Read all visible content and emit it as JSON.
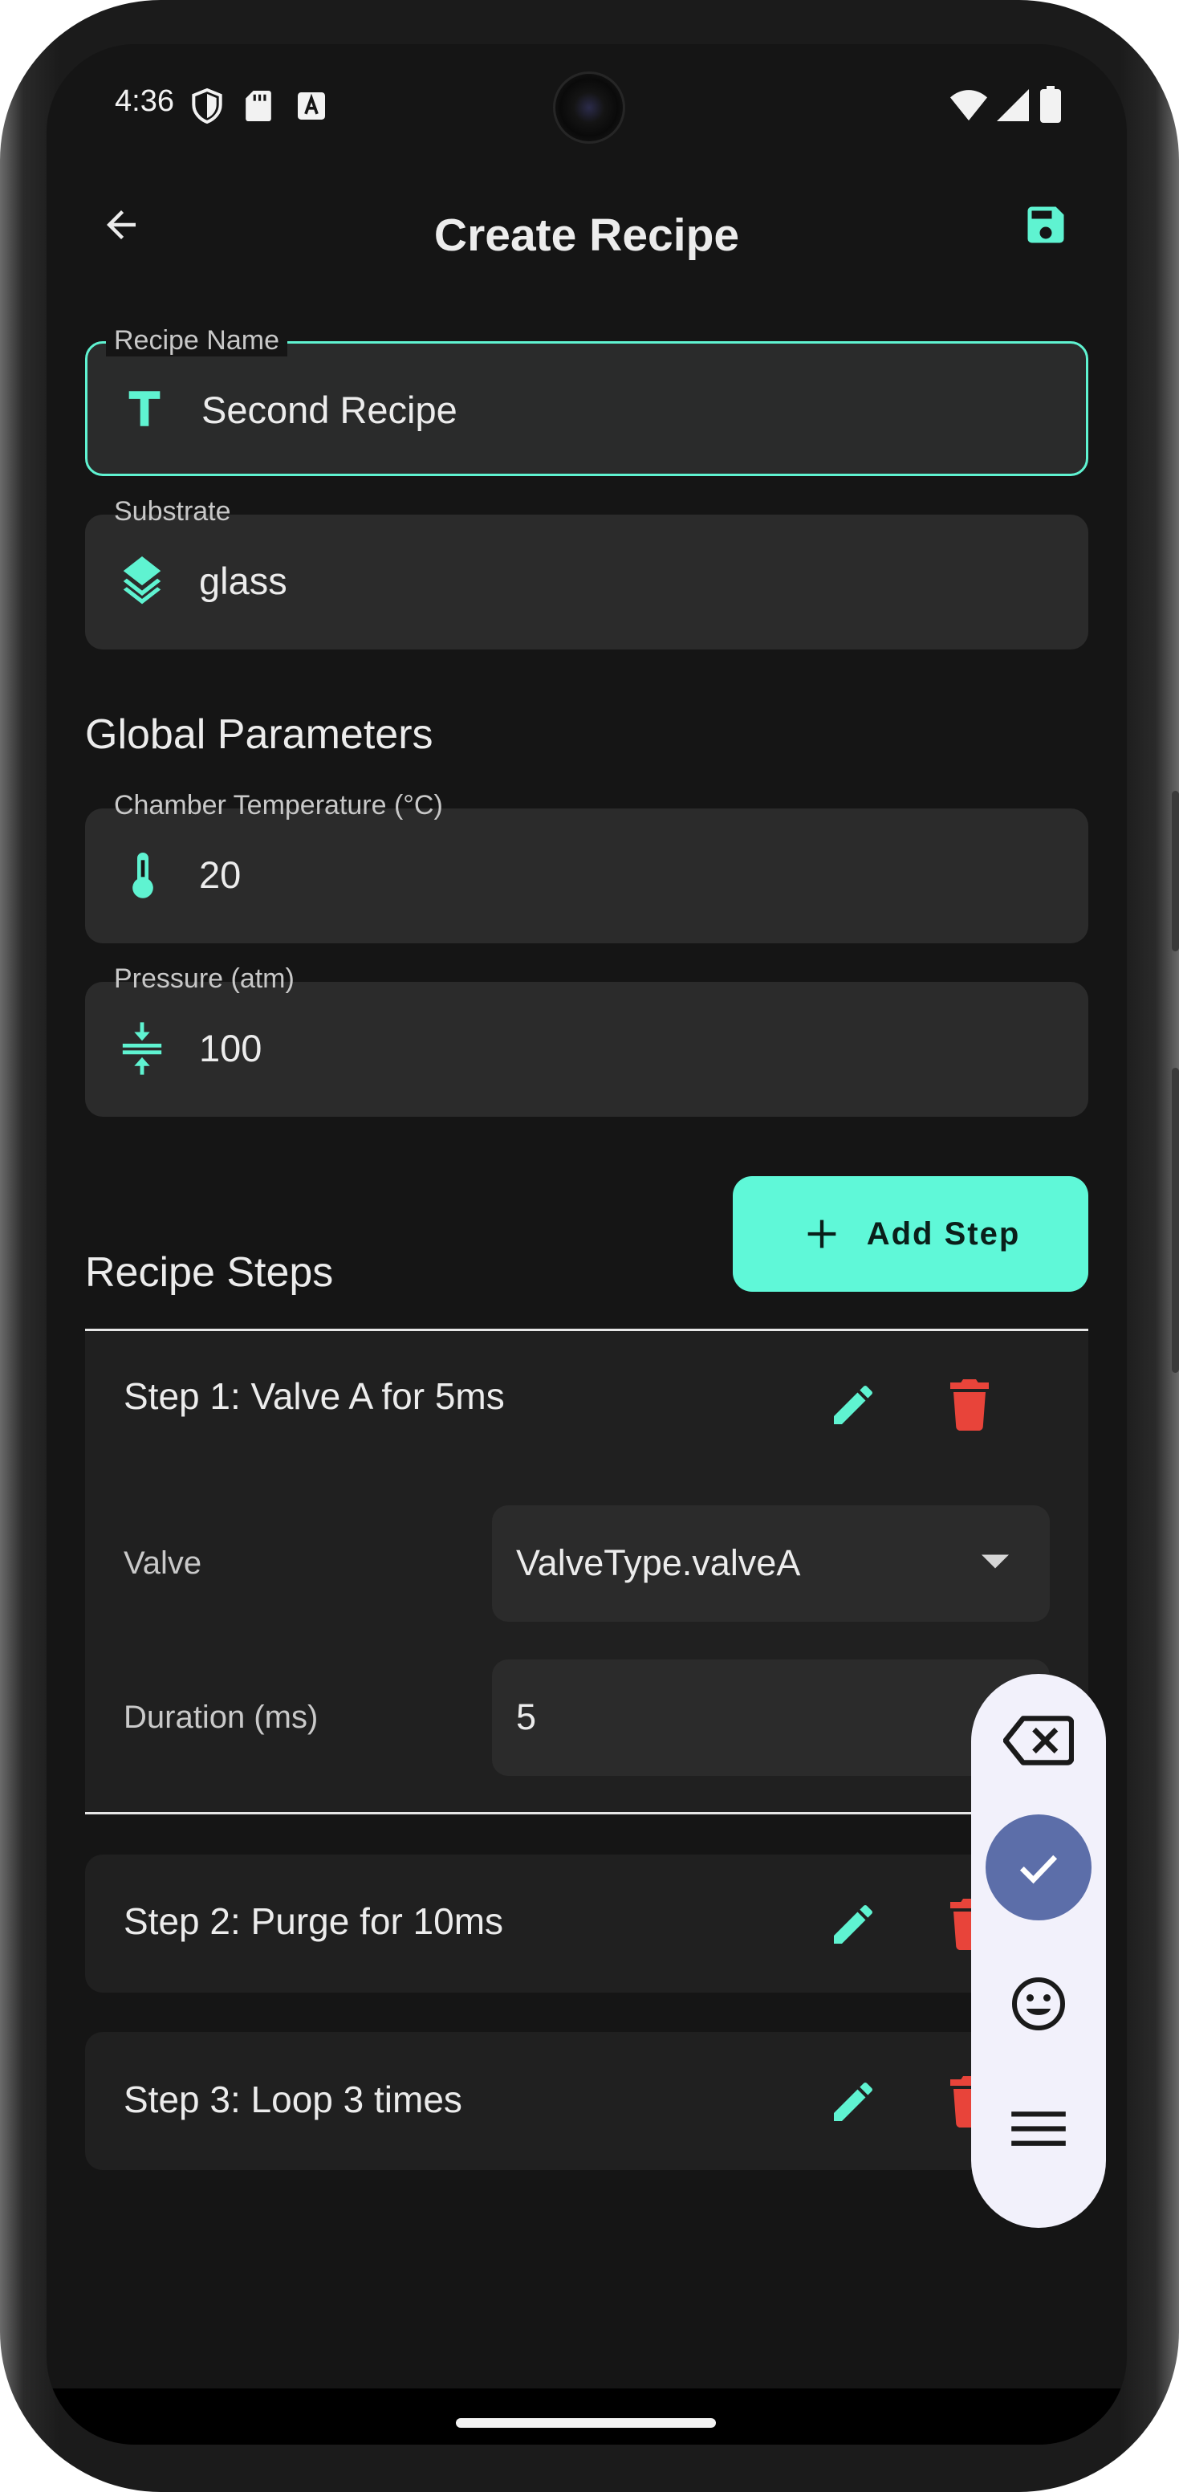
{
  "status_bar": {
    "time": "4:36"
  },
  "app_bar": {
    "title": "Create Recipe",
    "back_icon": "arrow-left-icon",
    "save_icon": "floppy-disk-icon"
  },
  "recipe_name": {
    "label": "Recipe Name",
    "value": "Second Recipe",
    "icon": "text-t-icon"
  },
  "substrate": {
    "label": "Substrate",
    "value": "glass",
    "icon": "layers-icon"
  },
  "global_parameters": {
    "title": "Global Parameters",
    "chamber_temperature": {
      "label": "Chamber Temperature (°C)",
      "value": "20",
      "icon": "thermometer-icon"
    },
    "pressure": {
      "label": "Pressure (atm)",
      "value": "100",
      "icon": "compress-icon"
    }
  },
  "recipe_steps": {
    "title": "Recipe Steps",
    "add_button_label": "Add Step",
    "steps": [
      {
        "title": "Step 1: Valve A for 5ms",
        "expanded": true,
        "valve_label": "Valve",
        "valve_value": "ValveType.valveA",
        "duration_label": "Duration (ms)",
        "duration_value": "5"
      },
      {
        "title": "Step 2: Purge for 10ms",
        "expanded": false
      },
      {
        "title": "Step 3: Loop 3 times",
        "expanded": false
      }
    ]
  },
  "keyboard_toolbar": {
    "items": [
      "backspace-icon",
      "check-icon",
      "emoji-icon",
      "menu-icon"
    ]
  },
  "colors": {
    "accent": "#5ff8d8",
    "delete": "#e8443a",
    "background": "#151515",
    "surface": "#2b2b2b"
  }
}
